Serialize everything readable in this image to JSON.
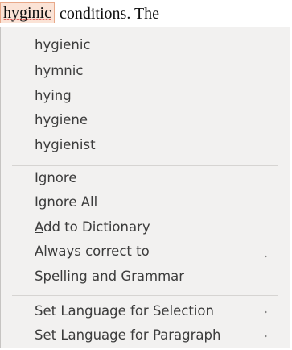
{
  "document": {
    "misspelled_word": "hyginic",
    "following_text": "conditions. The"
  },
  "context_menu": {
    "suggestions": [
      "hygienic",
      "hymnic",
      "hying",
      "hygiene",
      "hygienist"
    ],
    "ignore_label": "Ignore",
    "ignore_all_label": "Ignore All",
    "add_to_dictionary": {
      "accel": "A",
      "rest": "dd to Dictionary"
    },
    "always_correct_label": "Always correct to",
    "spelling_grammar_label": "Spelling and Grammar",
    "set_language_selection_label": "Set Language for Selection",
    "set_language_paragraph_label": "Set Language for Paragraph",
    "submenu_arrow_icon": "triangle-right"
  }
}
